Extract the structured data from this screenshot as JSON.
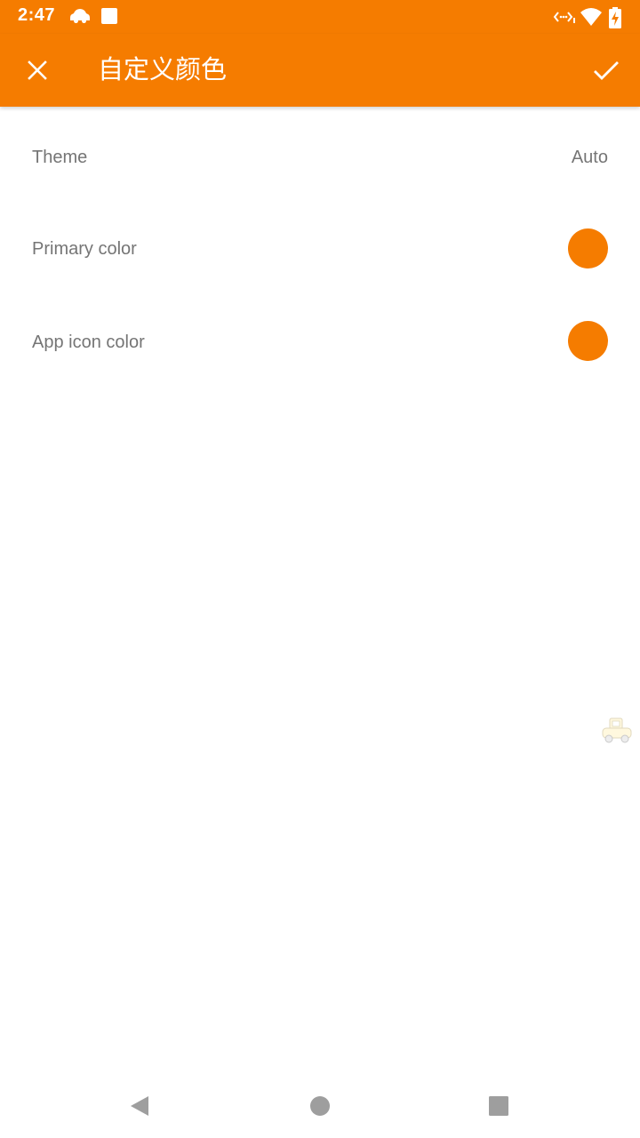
{
  "status_bar": {
    "time": "2:47",
    "left_icons": [
      "car-notification-icon",
      "square-notification-icon"
    ],
    "right_icons": [
      "data-transfer-icon",
      "wifi-icon",
      "battery-charging-icon"
    ]
  },
  "app_bar": {
    "title": "自定义颜色",
    "close_icon": "close-icon",
    "confirm_icon": "check-icon"
  },
  "settings": {
    "theme": {
      "label": "Theme",
      "value": "Auto"
    },
    "primary_color": {
      "label": "Primary color",
      "color": "#f57c00"
    },
    "app_icon_color": {
      "label": "App icon color",
      "color": "#f57c00"
    }
  },
  "colors": {
    "accent": "#f57c00",
    "text_secondary": "#757575",
    "nav_icon": "#9e9e9e"
  },
  "nav_bar": {
    "buttons": [
      "back-icon",
      "home-icon",
      "recents-icon"
    ]
  }
}
